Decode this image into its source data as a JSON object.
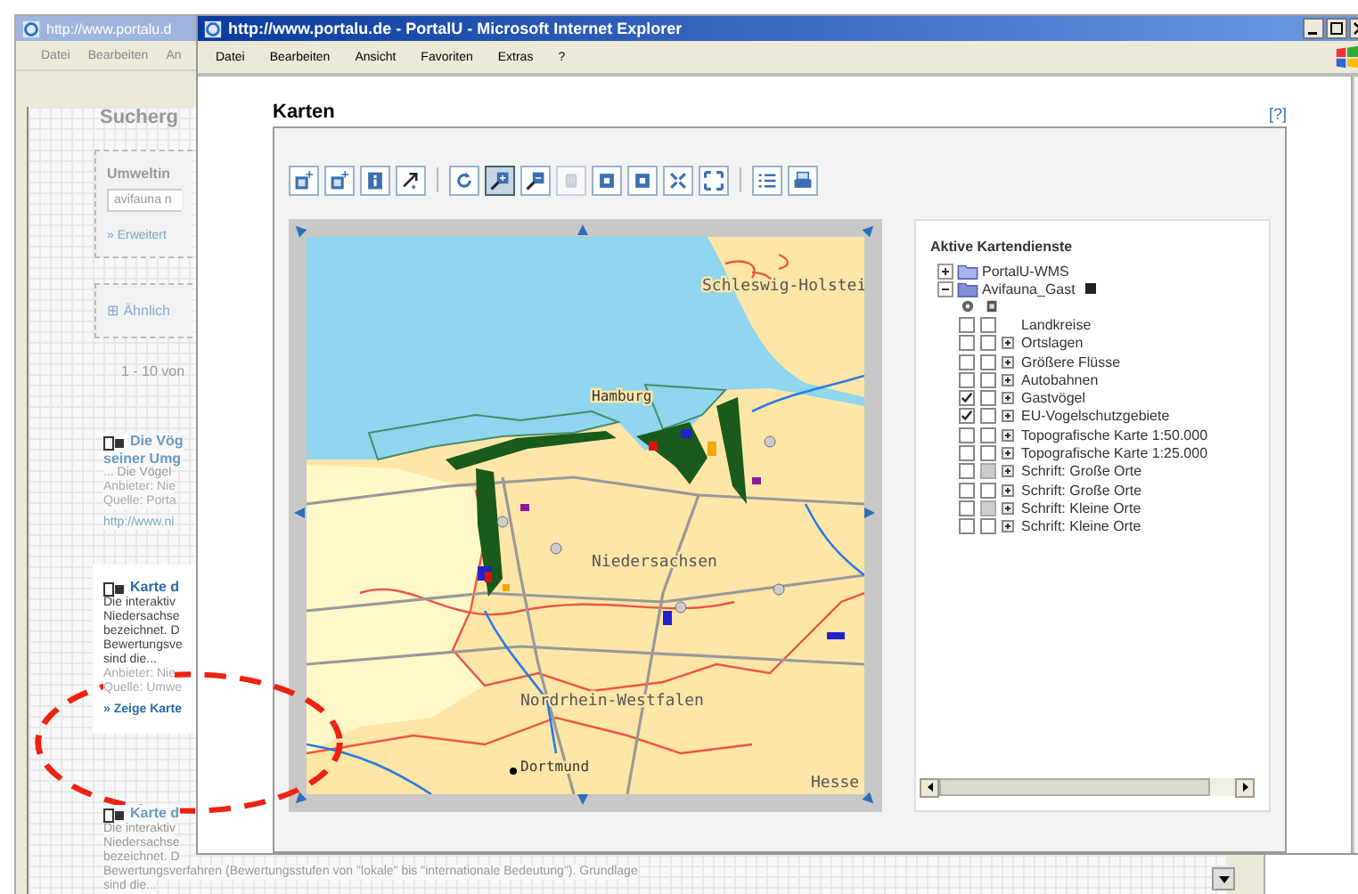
{
  "background_window": {
    "title": "http://www.portalu.d",
    "menu": [
      "Datei",
      "Bearbeiten",
      "An"
    ],
    "heading": "Sucherg",
    "search_box": {
      "title": "Umweltin",
      "value": "avifauna n",
      "link": "» Erweitert"
    },
    "similar": "⊞ Ähnlich",
    "count": "1 - 10 von",
    "results": [
      {
        "title_lines": [
          "Die Vög",
          "seiner Umg"
        ],
        "highlighted": false,
        "lines": [
          "... Die Vögel"
        ],
        "meta": [
          "Anbieter: Nie",
          "Quelle: Porta"
        ],
        "link": "http://www.ni"
      },
      {
        "title_lines": [
          "Karte d"
        ],
        "highlighted": true,
        "lines": [
          "Die interaktiv",
          "Niedersachse",
          "bezeichnet. D",
          "Bewertungsve",
          "sind die..."
        ],
        "meta": [
          "Anbieter: Nie",
          "Quelle: Umwe"
        ],
        "link": "» Zeige Karte"
      },
      {
        "title_lines": [
          "Karte d"
        ],
        "highlighted": false,
        "lines": [
          "Die interaktiv",
          "Niedersachse",
          "bezeichnet. D",
          "Bewertungsverfahren (Bewertungsstufen von \"lokale\" bis \"internationale Bedeutung\"). Grundlage",
          "sind die..."
        ]
      }
    ]
  },
  "window": {
    "title": "http://www.portalu.de - PortalU - Microsoft Internet Explorer",
    "menu": [
      "Datei",
      "Bearbeiten",
      "Ansicht",
      "Favoriten",
      "Extras",
      "?"
    ]
  },
  "page": {
    "heading": "Karten",
    "help": "[?]"
  },
  "toolbar": [
    {
      "kind": "add-layer",
      "selected": false,
      "disabled": false
    },
    {
      "kind": "add-layer",
      "selected": false,
      "disabled": false
    },
    {
      "kind": "info",
      "selected": false,
      "disabled": false
    },
    {
      "kind": "pointer",
      "selected": false,
      "disabled": false
    },
    {
      "kind": "refresh",
      "selected": false,
      "disabled": false
    },
    {
      "kind": "zoom-in",
      "selected": true,
      "disabled": false
    },
    {
      "kind": "zoom-out",
      "selected": false,
      "disabled": false
    },
    {
      "kind": "hand",
      "selected": false,
      "disabled": true
    },
    {
      "kind": "square",
      "selected": false,
      "disabled": false
    },
    {
      "kind": "square",
      "selected": false,
      "disabled": false
    },
    {
      "kind": "shrink",
      "selected": false,
      "disabled": false
    },
    {
      "kind": "expand",
      "selected": false,
      "disabled": false
    },
    {
      "kind": "list",
      "selected": false,
      "disabled": false
    },
    {
      "kind": "printer",
      "selected": false,
      "disabled": false
    }
  ],
  "map": {
    "labels": [
      {
        "text": "Schleswig-Holstei",
        "kind": "region"
      },
      {
        "text": "Hamburg",
        "kind": "city"
      },
      {
        "text": "Niedersachsen",
        "kind": "region"
      },
      {
        "text": "Nordrhein-Westfalen",
        "kind": "region"
      },
      {
        "text": "Dortmund",
        "kind": "city"
      },
      {
        "text": "Hesse",
        "kind": "region"
      }
    ]
  },
  "layers_panel": {
    "title": "Aktive Kartendienste",
    "services": [
      {
        "name": "PortalU-WMS",
        "expanded": false
      },
      {
        "name": "Avifauna_Gast",
        "expanded": true,
        "layers": [
          {
            "name": "Landkreise",
            "visible": false,
            "info_disabled": false,
            "legend": false
          },
          {
            "name": "Ortslagen",
            "visible": false,
            "info_disabled": false,
            "legend": true
          },
          {
            "name": "Größere Flüsse",
            "visible": false,
            "info_disabled": false,
            "legend": true
          },
          {
            "name": "Autobahnen",
            "visible": false,
            "info_disabled": false,
            "legend": true
          },
          {
            "name": "Gastvögel",
            "visible": true,
            "info_disabled": false,
            "legend": true
          },
          {
            "name": "EU-Vogelschutzgebiete",
            "visible": true,
            "info_disabled": false,
            "legend": true
          },
          {
            "name": "Topografische Karte 1:50.000",
            "visible": false,
            "info_disabled": false,
            "legend": true
          },
          {
            "name": "Topografische Karte 1:25.000",
            "visible": false,
            "info_disabled": false,
            "legend": true
          },
          {
            "name": "Schrift: Große Orte",
            "visible": false,
            "info_disabled": true,
            "legend": true
          },
          {
            "name": "Schrift: Große Orte",
            "visible": false,
            "info_disabled": false,
            "legend": true
          },
          {
            "name": "Schrift: Kleine Orte",
            "visible": false,
            "info_disabled": true,
            "legend": true
          },
          {
            "name": "Schrift: Kleine Orte",
            "visible": false,
            "info_disabled": false,
            "legend": true
          }
        ]
      }
    ]
  }
}
